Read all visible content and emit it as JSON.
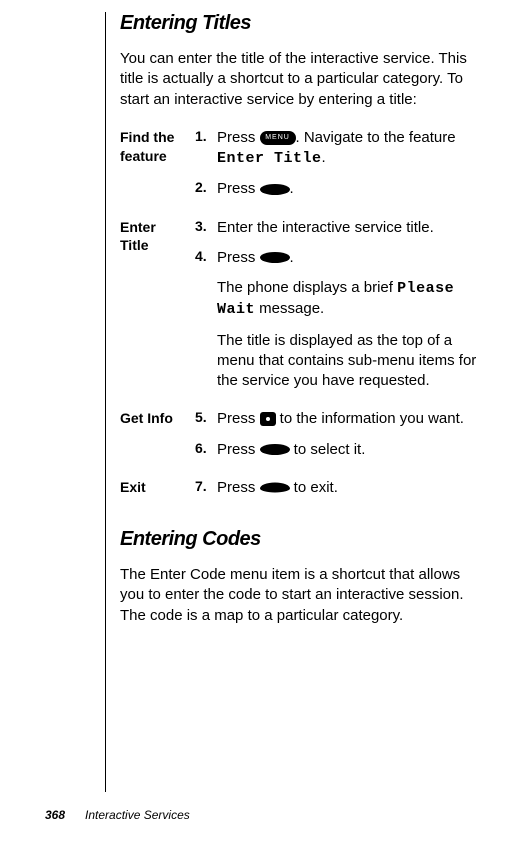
{
  "section1": {
    "heading": "Entering Titles",
    "intro": "You can enter the title of the interactive service. This title is actually a shortcut to a particular category. To start an interactive service by entering a title:"
  },
  "blocks": {
    "find": {
      "label_line1": "Find the",
      "label_line2": "feature",
      "step1_num": "1.",
      "step1_a": "Press ",
      "step1_b": ". Navigate to the feature ",
      "step1_code": "Enter Title",
      "step1_c": ".",
      "step2_num": "2.",
      "step2_a": "Press ",
      "step2_c": "."
    },
    "enter": {
      "label_line1": "Enter",
      "label_line2": "Title",
      "step3_num": "3.",
      "step3_text": "Enter the interactive service title.",
      "step4_num": "4.",
      "step4_a": "Press ",
      "step4_c": ".",
      "step4_sub1_a": "The phone displays a brief ",
      "step4_sub1_code": "Please Wait",
      "step4_sub1_c": " message.",
      "step4_sub2": "The title is displayed as the top of a menu that contains sub-menu items for the service you have requested."
    },
    "getinfo": {
      "label": "Get Info",
      "step5_num": "5.",
      "step5_a": "Press ",
      "step5_c": " to the information you want.",
      "step6_num": "6.",
      "step6_a": "Press ",
      "step6_c": " to select it."
    },
    "exit": {
      "label": "Exit",
      "step7_num": "7.",
      "step7_a": "Press ",
      "step7_c": " to exit."
    }
  },
  "section2": {
    "heading": "Entering Codes",
    "intro": "The Enter Code menu item is a shortcut that allows you to enter the code to start an interactive session. The code is a map to a particular category."
  },
  "footer": {
    "page": "368",
    "title": "Interactive Services"
  },
  "icons": {
    "menu_label": "MENU"
  }
}
